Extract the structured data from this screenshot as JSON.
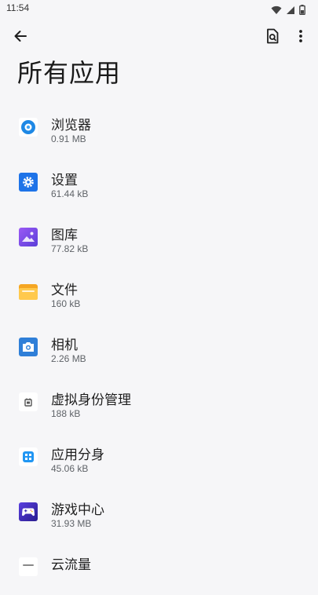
{
  "status": {
    "time": "11:54"
  },
  "toolbar": {
    "back_icon": "arrow-back-icon",
    "search_icon": "search-document-icon",
    "more_icon": "more-vert-icon"
  },
  "page": {
    "title": "所有应用"
  },
  "apps": [
    {
      "name": "浏览器",
      "size": "0.91 MB",
      "icon": "browser-icon",
      "color": "#1e88e5"
    },
    {
      "name": "设置",
      "size": "61.44 kB",
      "icon": "settings-icon",
      "color": "#1e73e8"
    },
    {
      "name": "图库",
      "size": "77.82 kB",
      "icon": "gallery-icon",
      "color": "#7c4dff"
    },
    {
      "name": "文件",
      "size": "160 kB",
      "icon": "files-icon",
      "color": "#f5a623"
    },
    {
      "name": "相机",
      "size": "2.26 MB",
      "icon": "camera-icon",
      "color": "#2f7fd8"
    },
    {
      "name": "虚拟身份管理",
      "size": "188 kB",
      "icon": "virtual-identity-icon",
      "color": "#555555"
    },
    {
      "name": "应用分身",
      "size": "45.06 kB",
      "icon": "app-clone-icon",
      "color": "#2196f3"
    },
    {
      "name": "游戏中心",
      "size": "31.93 MB",
      "icon": "game-center-icon",
      "color": "#3d2bb5"
    },
    {
      "name": "云流量",
      "size": "",
      "icon": "cloud-traffic-icon",
      "color": "#888888"
    }
  ]
}
